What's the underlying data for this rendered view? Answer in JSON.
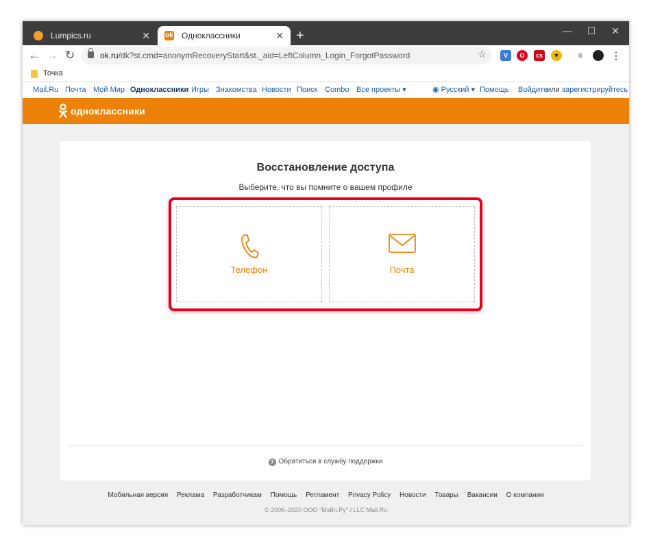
{
  "browser": {
    "tabs": [
      {
        "title": "Lumpics.ru",
        "close": "✕"
      },
      {
        "title": "Одноклассники",
        "close": "✕"
      }
    ],
    "new_tab": "+",
    "window_controls": {
      "minimize": "—",
      "maximize": "☐",
      "close": "✕"
    },
    "url_host": "ok.ru",
    "url_path": "/dk?st.cmd=anonymRecoveryStart&st._aid=LeftColumn_Login_ForgotPassword",
    "bookmarks": [
      {
        "label": "Точка"
      }
    ]
  },
  "portal_nav": {
    "items": [
      "Mail.Ru",
      "Почта",
      "Мой Мир",
      "Одноклассники",
      "Игры",
      "Знакомства",
      "Новости",
      "Поиск",
      "Combo",
      "Все проекты ▾"
    ],
    "language": "Русский ▾",
    "help": "Помощь",
    "login": "Войдите",
    "or": "или",
    "register": "зарегистрируйтесь"
  },
  "ok_header": {
    "brand": "одноклассники",
    "brand_color": "#ee8208"
  },
  "recovery": {
    "title": "Восстановление доступа",
    "subtitle": "Выберите, что вы помните о вашем профиле",
    "options": [
      {
        "label": "Телефон",
        "icon": "phone-icon"
      },
      {
        "label": "Почта",
        "icon": "mail-icon"
      }
    ],
    "highlight_color": "#e8001d",
    "support_link": "Обратиться в службу поддержки"
  },
  "footer": {
    "links": [
      "Мобильная версия",
      "Реклама",
      "Разработчикам",
      "Помощь",
      "Регламент",
      "Privacy Policy",
      "Новости",
      "Товары",
      "Вакансии",
      "О компании"
    ],
    "copyright": "© 2006–2020 ООО \"Мэйл.Ру\" / LLC Mail.Ru"
  }
}
